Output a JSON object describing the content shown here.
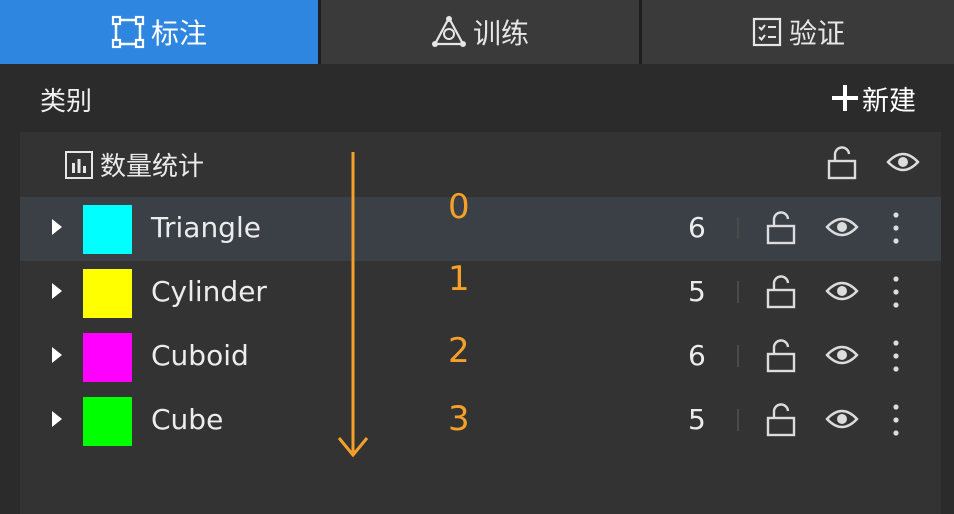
{
  "tabs": [
    {
      "label": "标注",
      "icon": "bounding-box-icon",
      "active": true
    },
    {
      "label": "训练",
      "icon": "training-network-icon",
      "active": false
    },
    {
      "label": "验证",
      "icon": "checklist-icon",
      "active": false
    }
  ],
  "category_header": {
    "title": "类别",
    "new_label": "新建"
  },
  "stats": {
    "label": "数量统计",
    "icon": "bar-chart-icon"
  },
  "categories": [
    {
      "label": "Triangle",
      "count": "6",
      "color": "#00ffff",
      "selected": true
    },
    {
      "label": "Cylinder",
      "count": "5",
      "color": "#ffff00",
      "selected": false
    },
    {
      "label": "Cuboid",
      "count": "6",
      "color": "#ff00ff",
      "selected": false
    },
    {
      "label": "Cube",
      "count": "5",
      "color": "#00ff00",
      "selected": false
    }
  ],
  "annotation": {
    "indices": [
      "0",
      "1",
      "2",
      "3"
    ],
    "color": "#f5a028"
  }
}
